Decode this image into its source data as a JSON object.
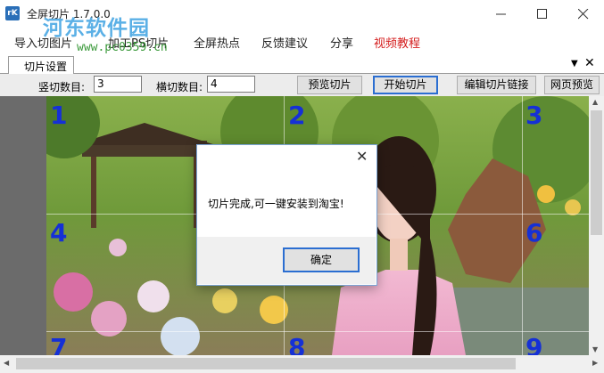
{
  "window": {
    "title": "全屏切片 1.7.0.0",
    "app_icon_text": "rK",
    "watermark": "河东软件园",
    "watermark_url": "www.pc0359.cn"
  },
  "menu": {
    "items": [
      {
        "label": "导入切图片",
        "color": "#222222"
      },
      {
        "label": "加工PS切片",
        "color": "#222222"
      },
      {
        "label": "全屏热点",
        "color": "#222222"
      },
      {
        "label": "反馈建议",
        "color": "#222222"
      },
      {
        "label": "分享",
        "color": "#222222"
      },
      {
        "label": "视频教程",
        "color": "#d41c1c"
      }
    ]
  },
  "tab": {
    "label": "切片设置",
    "dropdown_icon": "chevron-down-icon",
    "close_icon": "close-icon"
  },
  "toolbar": {
    "vertical_label": "竖切数目:",
    "vertical_value": "3",
    "horizontal_label": "横切数目:",
    "horizontal_value": "4",
    "preview_slices": "预览切片",
    "start_slicing": "开始切片",
    "edit_links": "编辑切片链接",
    "web_preview": "网页预览"
  },
  "slices": {
    "numbers": [
      "1",
      "2",
      "3",
      "4",
      "6",
      "7",
      "8",
      "9"
    ]
  },
  "dialog": {
    "message": "切片完成,可一键安装到淘宝!",
    "ok_label": "确定"
  },
  "colors": {
    "slice_number": "#1530d6",
    "accent_blue": "#2b6ed1",
    "menu_red": "#d41c1c"
  }
}
